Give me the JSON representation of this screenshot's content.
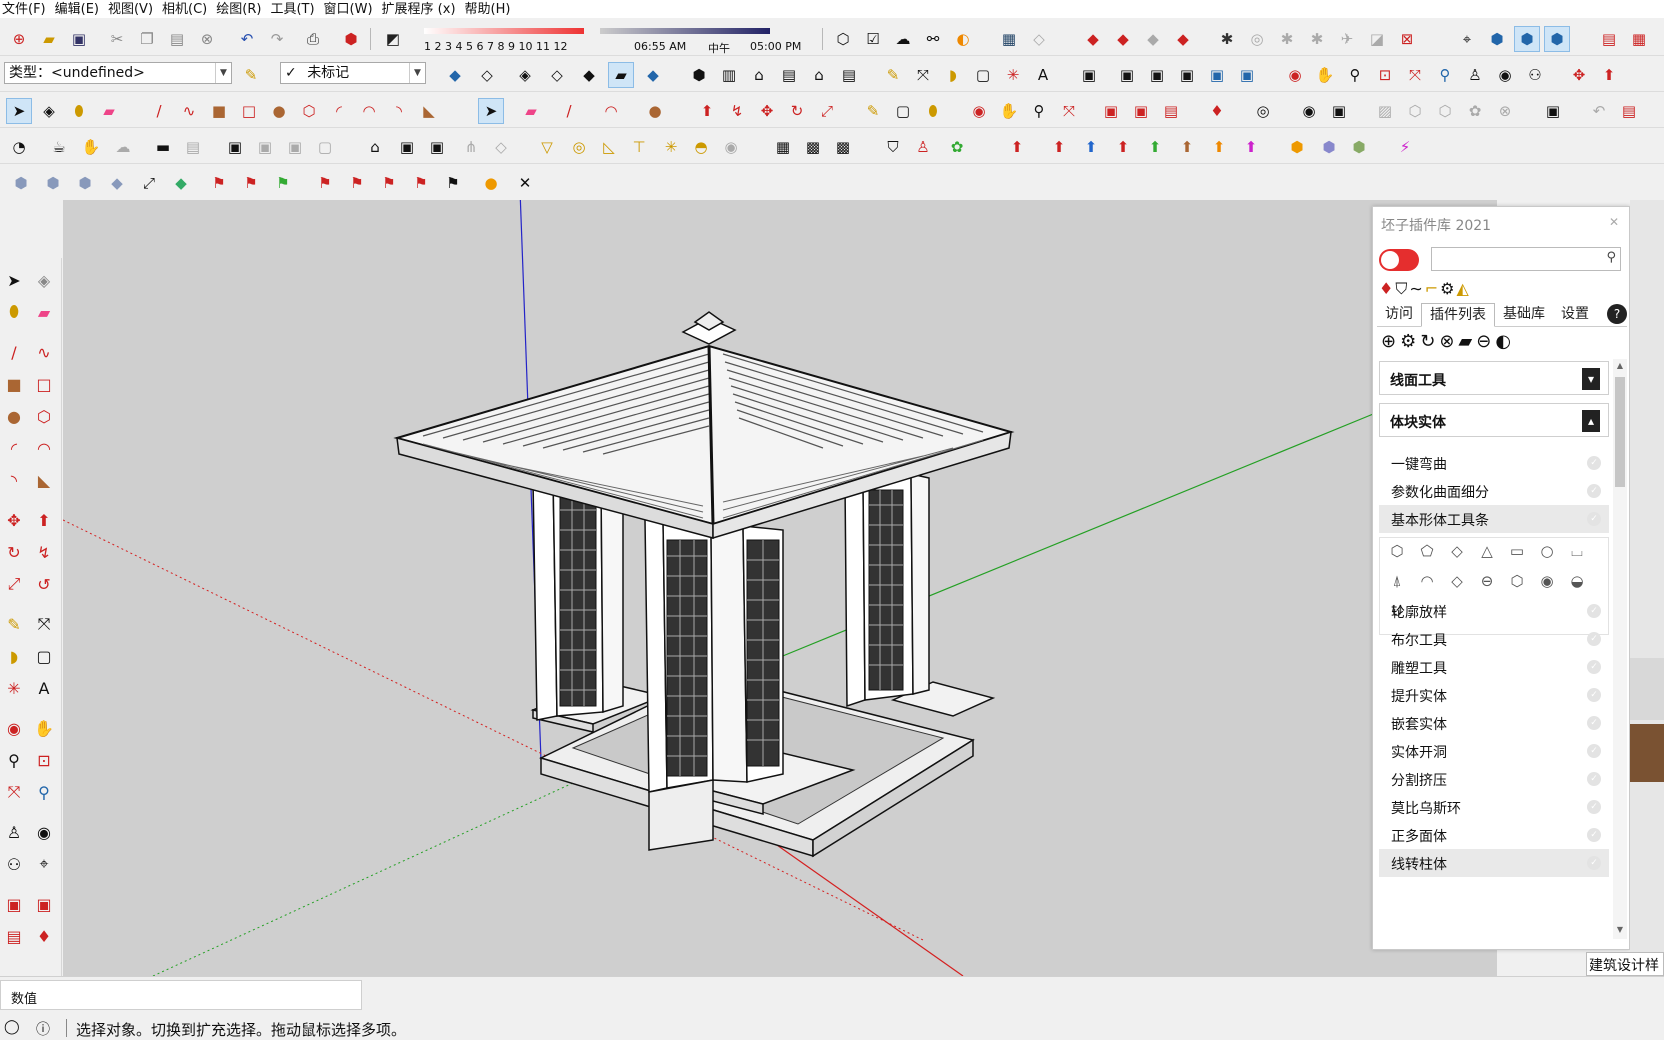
{
  "menu": [
    "文件(F)",
    "编辑(E)",
    "视图(V)",
    "相机(C)",
    "绘图(R)",
    "工具(T)",
    "窗口(W)",
    "扩展程序 (x)",
    "帮助(H)"
  ],
  "shadow": {
    "months": "1 2 3 4 5 6 7 8 9 10 11 12",
    "time_start": "06:55 AM",
    "time_noon": "中午",
    "time_end": "05:00 PM"
  },
  "style_combo": {
    "label": "类型：<undefined>"
  },
  "tag_combo": {
    "check": "✓",
    "label": "未标记"
  },
  "plugin_panel": {
    "title": "坯子插件库 2021",
    "tabs": [
      "访问",
      "插件列表",
      "基础库",
      "设置"
    ],
    "help": "?",
    "section1": "线面工具",
    "section2": "体块实体",
    "items": [
      "一键弯曲",
      "参数化曲面细分",
      "基本形体工具条",
      "轮廓放样",
      "布尔工具",
      "雕塑工具",
      "提升实体",
      "嵌套实体",
      "实体开洞",
      "分割挤压",
      "莫比乌斯环",
      "正多面体",
      "线转柱体"
    ]
  },
  "corner_label": "建筑设计样",
  "measurements_label": "数值",
  "status_text": "选择对象。切换到扩充选择。拖动鼠标选择多项。",
  "colors": {
    "axis_red": "#d42020",
    "axis_green": "#24a024",
    "axis_blue": "#2424c8",
    "viewport": "#cfcfcf",
    "toggle": "#e52e2e"
  }
}
